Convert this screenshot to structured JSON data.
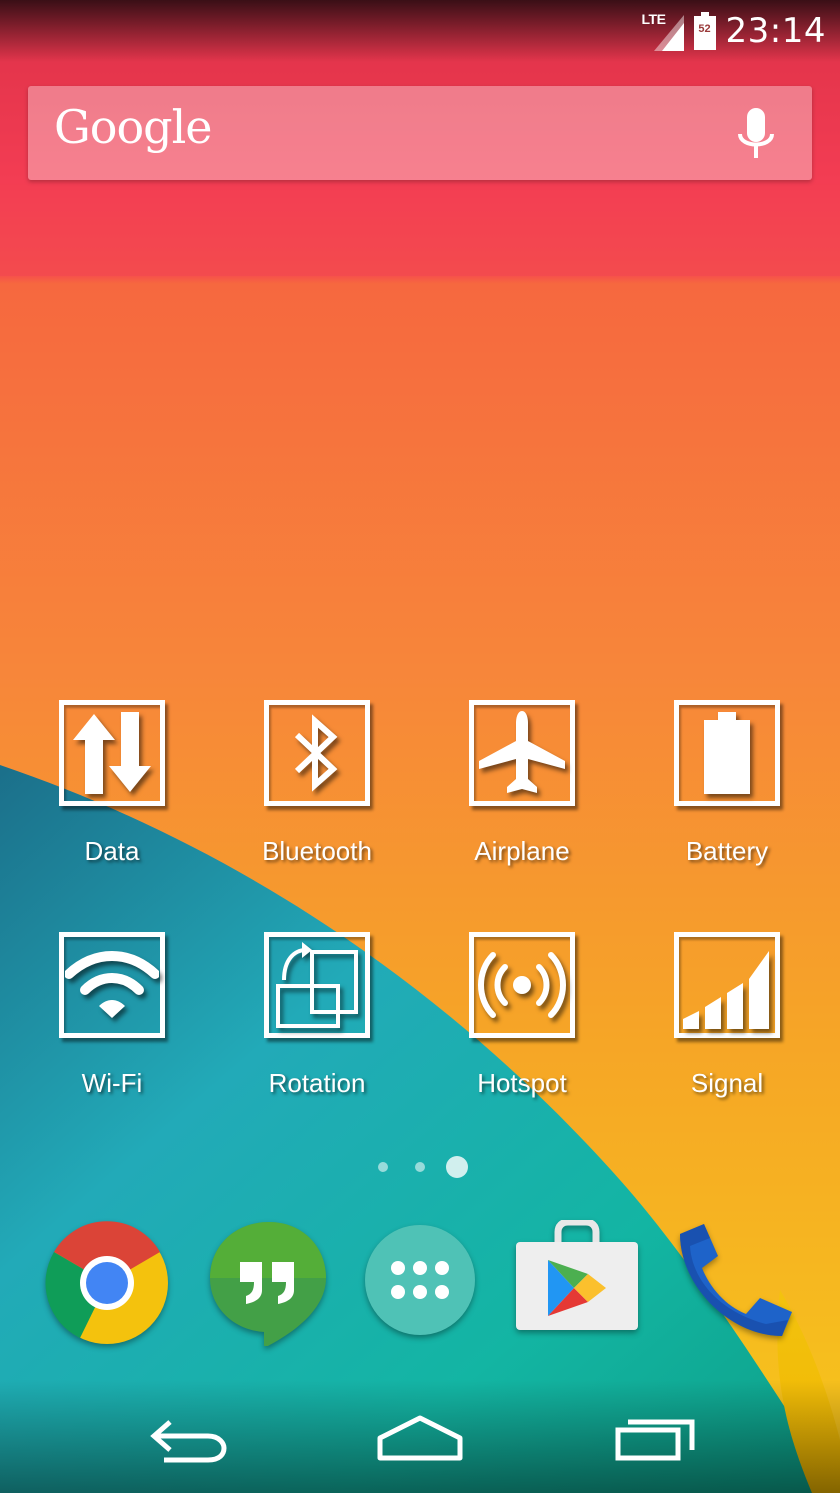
{
  "status_bar": {
    "network_label": "LTE",
    "battery_level": "52",
    "time": "23:14"
  },
  "search": {
    "logo_text": "Google"
  },
  "widget": {
    "toggles": [
      {
        "id": "data",
        "label": "Data",
        "icon": "data-arrows-icon"
      },
      {
        "id": "bluetooth",
        "label": "Bluetooth",
        "icon": "bluetooth-icon"
      },
      {
        "id": "airplane",
        "label": "Airplane",
        "icon": "airplane-icon"
      },
      {
        "id": "battery",
        "label": "Battery",
        "icon": "battery-icon"
      },
      {
        "id": "wifi",
        "label": "Wi-Fi",
        "icon": "wifi-icon"
      },
      {
        "id": "rotation",
        "label": "Rotation",
        "icon": "rotation-icon"
      },
      {
        "id": "hotspot",
        "label": "Hotspot",
        "icon": "hotspot-icon"
      },
      {
        "id": "signal",
        "label": "Signal",
        "icon": "signal-icon"
      }
    ]
  },
  "page_indicator": {
    "pages": 3,
    "current_page": 3
  },
  "dock": {
    "apps": [
      {
        "id": "chrome",
        "icon": "chrome-icon"
      },
      {
        "id": "hangouts",
        "icon": "hangouts-icon"
      },
      {
        "id": "app-drawer",
        "icon": "app-drawer-icon"
      },
      {
        "id": "play-store",
        "icon": "play-store-icon"
      },
      {
        "id": "phone",
        "icon": "phone-icon"
      }
    ]
  },
  "nav": {
    "buttons": [
      {
        "id": "back",
        "icon": "back-icon"
      },
      {
        "id": "home",
        "icon": "home-icon"
      },
      {
        "id": "recents",
        "icon": "recents-icon"
      }
    ]
  },
  "colors": {
    "wallpaper_top": "#f63c52",
    "wallpaper_orange": "#f78c33",
    "wallpaper_yellow": "#f6c21a",
    "wallpaper_teal": "#1eb6ad"
  }
}
